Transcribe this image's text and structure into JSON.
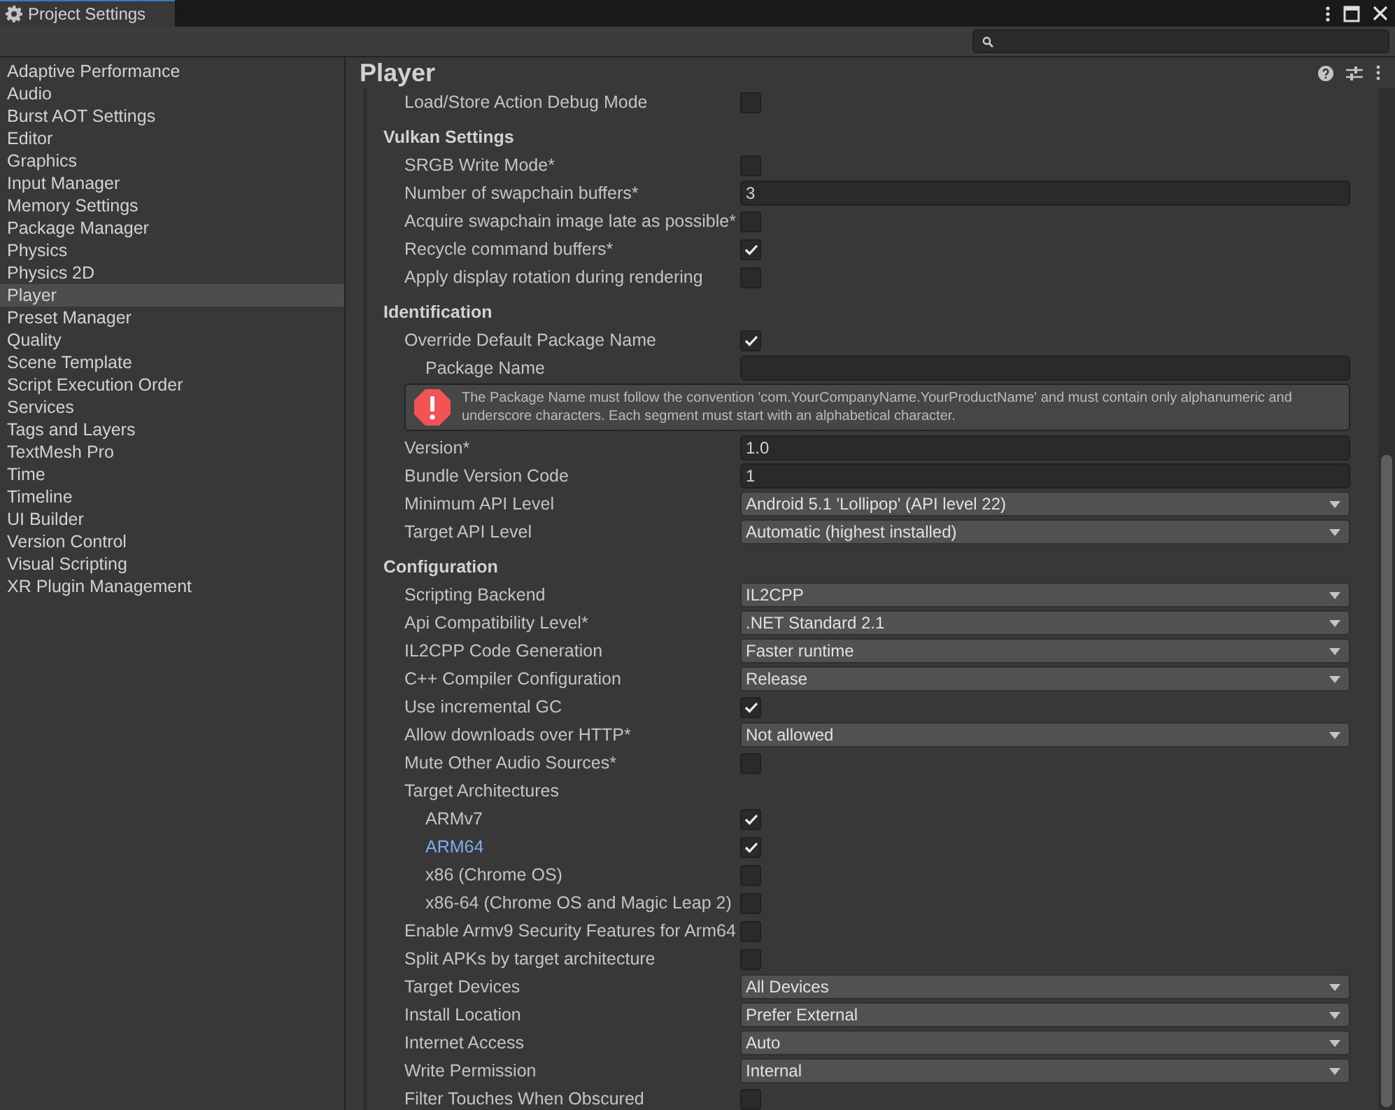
{
  "window": {
    "title": "Project Settings"
  },
  "sidebar": {
    "items": [
      {
        "label": "Adaptive Performance",
        "selected": false
      },
      {
        "label": "Audio",
        "selected": false
      },
      {
        "label": "Burst AOT Settings",
        "selected": false
      },
      {
        "label": "Editor",
        "selected": false
      },
      {
        "label": "Graphics",
        "selected": false
      },
      {
        "label": "Input Manager",
        "selected": false
      },
      {
        "label": "Memory Settings",
        "selected": false
      },
      {
        "label": "Package Manager",
        "selected": false
      },
      {
        "label": "Physics",
        "selected": false
      },
      {
        "label": "Physics 2D",
        "selected": false
      },
      {
        "label": "Player",
        "selected": true
      },
      {
        "label": "Preset Manager",
        "selected": false
      },
      {
        "label": "Quality",
        "selected": false
      },
      {
        "label": "Scene Template",
        "selected": false
      },
      {
        "label": "Script Execution Order",
        "selected": false
      },
      {
        "label": "Services",
        "selected": false
      },
      {
        "label": "Tags and Layers",
        "selected": false
      },
      {
        "label": "TextMesh Pro",
        "selected": false
      },
      {
        "label": "Time",
        "selected": false
      },
      {
        "label": "Timeline",
        "selected": false
      },
      {
        "label": "UI Builder",
        "selected": false
      },
      {
        "label": "Version Control",
        "selected": false
      },
      {
        "label": "Visual Scripting",
        "selected": false
      },
      {
        "label": "XR Plugin Management",
        "selected": false
      }
    ]
  },
  "panel": {
    "title": "Player",
    "sections": [
      {
        "rows": [
          {
            "kind": "checkbox",
            "label": "Load/Store Action Debug Mode",
            "checked": false
          }
        ]
      },
      {
        "title": "Vulkan Settings",
        "rows": [
          {
            "kind": "checkbox",
            "label": "SRGB Write Mode*",
            "checked": false
          },
          {
            "kind": "text",
            "label": "Number of swapchain buffers*",
            "value": "3"
          },
          {
            "kind": "checkbox",
            "label": "Acquire swapchain image late as possible*",
            "checked": false
          },
          {
            "kind": "checkbox",
            "label": "Recycle command buffers*",
            "checked": true
          },
          {
            "kind": "checkbox",
            "label": "Apply display rotation during rendering",
            "checked": false
          }
        ]
      },
      {
        "title": "Identification",
        "rows": [
          {
            "kind": "checkbox",
            "label": "Override Default Package Name",
            "checked": true,
            "children": [
              {
                "kind": "text",
                "label": "Package Name"
              },
              {
                "kind": "error",
                "message": "The Package Name must follow the convention 'com.YourCompanyName.YourProductName' and must contain only alphanumeric and underscore characters. Each segment must start with an alphabetical character."
              }
            ]
          },
          {
            "kind": "text",
            "label": "Version*",
            "value": "1.0"
          },
          {
            "kind": "text",
            "label": "Bundle Version Code",
            "value": "1"
          },
          {
            "kind": "dropdown",
            "label": "Minimum API Level",
            "value": "Android 5.1 'Lollipop' (API level 22)"
          },
          {
            "kind": "dropdown",
            "label": "Target API Level",
            "value": "Automatic (highest installed)"
          }
        ]
      },
      {
        "title": "Configuration",
        "rows": [
          {
            "kind": "dropdown",
            "label": "Scripting Backend",
            "value": "IL2CPP"
          },
          {
            "kind": "dropdown",
            "label": "Api Compatibility Level*",
            "value": ".NET Standard 2.1"
          },
          {
            "kind": "dropdown",
            "label": "IL2CPP Code Generation",
            "value": "Faster runtime"
          },
          {
            "kind": "dropdown",
            "label": "C++ Compiler Configuration",
            "value": "Release"
          },
          {
            "kind": "checkbox",
            "label": "Use incremental GC",
            "checked": true
          },
          {
            "kind": "dropdown",
            "label": "Allow downloads over HTTP*",
            "value": "Not allowed"
          },
          {
            "kind": "checkbox",
            "label": "Mute Other Audio Sources*",
            "checked": false
          },
          {
            "kind": "label",
            "label": "Target Architectures",
            "children": [
              {
                "kind": "checkbox",
                "label": "ARMv7",
                "checked": true,
                "selected": false
              },
              {
                "kind": "checkbox",
                "label": "ARM64",
                "checked": true,
                "selected": true
              },
              {
                "kind": "checkbox",
                "label": "x86 (Chrome OS)",
                "checked": false,
                "selected": false
              },
              {
                "kind": "checkbox",
                "label": "x86-64 (Chrome OS and Magic Leap 2)",
                "checked": false,
                "selected": false
              }
            ]
          },
          {
            "kind": "checkbox",
            "label": "Enable Armv9 Security Features for Arm64",
            "checked": false
          },
          {
            "kind": "checkbox",
            "label": "Split APKs by target architecture",
            "checked": false
          },
          {
            "kind": "dropdown",
            "label": "Target Devices",
            "value": "All Devices"
          },
          {
            "kind": "dropdown",
            "label": "Install Location",
            "value": "Prefer External"
          },
          {
            "kind": "dropdown",
            "label": "Internet Access",
            "value": "Auto"
          },
          {
            "kind": "dropdown",
            "label": "Write Permission",
            "value": "Internal"
          },
          {
            "kind": "checkbox",
            "label": "Filter Touches When Obscured",
            "checked": false
          }
        ]
      }
    ]
  }
}
